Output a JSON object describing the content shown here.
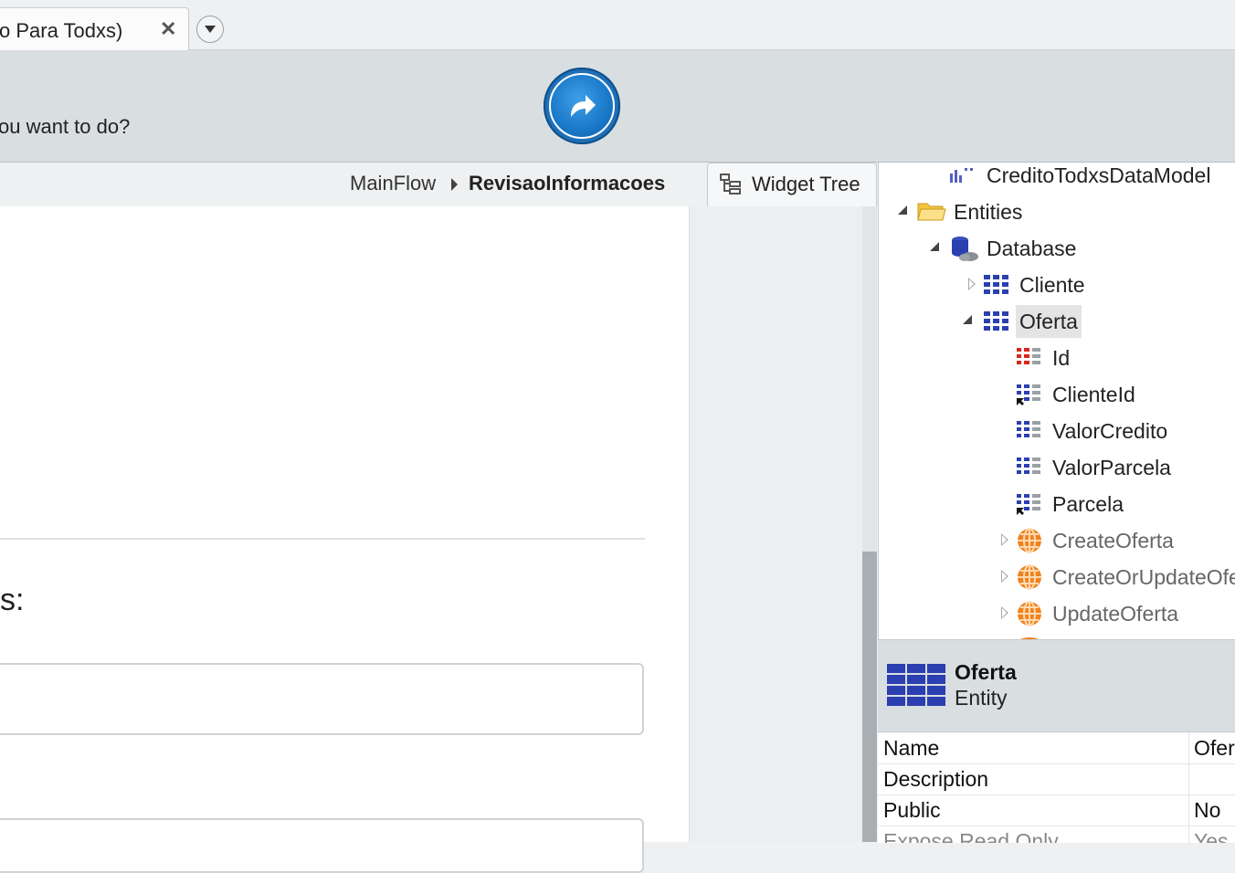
{
  "tab": {
    "label": "o Para Todxs)",
    "close_glyph": "✕"
  },
  "toolbar": {
    "question": "ou want to do?"
  },
  "breadcrumb": {
    "flow": "MainFlow",
    "screen": "RevisaoInformacoes"
  },
  "canvas": {
    "label_fragment": "s:"
  },
  "widget_tree": {
    "label": "Widget Tree"
  },
  "tree": {
    "data_model": "CreditoTodxsDataModel",
    "entities": "Entities",
    "database": "Database",
    "cliente": "Cliente",
    "oferta": "Oferta",
    "attributes": [
      "Id",
      "ClienteId",
      "ValorCredito",
      "ValorParcela",
      "Parcela"
    ],
    "actions": [
      "CreateOferta",
      "CreateOrUpdateOferta",
      "UpdateOferta"
    ]
  },
  "properties": {
    "title": "Oferta",
    "subtitle": "Entity",
    "rows": [
      {
        "key": "Name",
        "value": "Oferta"
      },
      {
        "key": "Description",
        "value": ""
      },
      {
        "key": "Public",
        "value": "No"
      },
      {
        "key": "Expose Read Only",
        "value": "Yes"
      }
    ]
  },
  "colors": {
    "publish": "#1978c8",
    "entity_blue": "#2b3fb0",
    "action_orange": "#f0821e",
    "pk_red": "#d9261c"
  }
}
